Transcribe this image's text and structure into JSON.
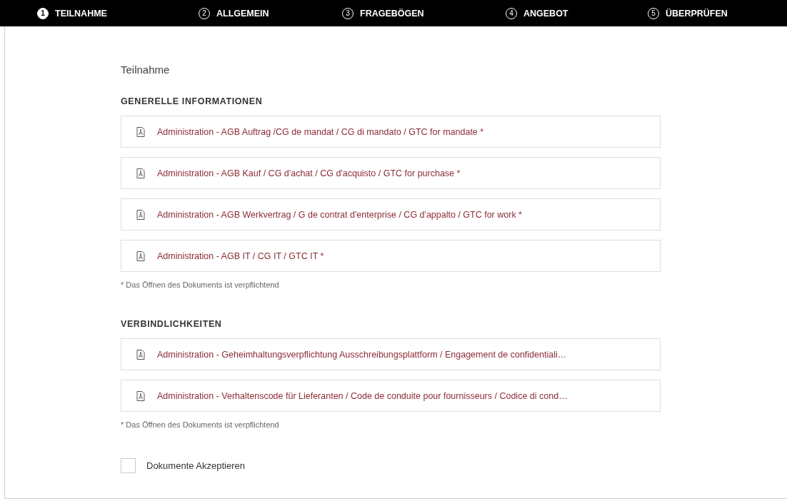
{
  "steps": [
    {
      "number": "1",
      "label": "TEILNAHME",
      "selected": true
    },
    {
      "number": "2",
      "label": "ALLGEMEIN",
      "selected": false
    },
    {
      "number": "3",
      "label": "FRAGEBÖGEN",
      "selected": false
    },
    {
      "number": "4",
      "label": "ANGEBOT",
      "selected": false
    },
    {
      "number": "5",
      "label": "ÜBERPRÜFEN",
      "selected": false
    }
  ],
  "page_title": "Teilnahme",
  "sections": [
    {
      "heading": "GENERELLE INFORMATIONEN",
      "documents": [
        "Administration - AGB Auftrag /CG de mandat / CG di mandato / GTC for mandate *",
        "Administration - AGB Kauf / CG d'achat / CG d'acquisto / GTC for purchase *",
        "Administration - AGB Werkvertrag / G de contrat d'enterprise / CG d'appalto / GTC for work *",
        "Administration - AGB IT / CG IT / GTC IT *"
      ],
      "note": "* Das Öffnen des Dokuments ist verpflichtend"
    },
    {
      "heading": "VERBINDLICHKEITEN",
      "documents": [
        "Administration - Geheimhaltungsverpflichtung Ausschreibungsplattform / Engagement de confidentiali…",
        "Administration - Verhaltenscode für Lieferanten / Code de conduite pour fournisseurs / Codice di cond…"
      ],
      "note": "* Das Öffnen des Dokuments ist verpflichtend"
    }
  ],
  "accept": {
    "label": "Dokumente Akzeptieren",
    "checked": false
  }
}
